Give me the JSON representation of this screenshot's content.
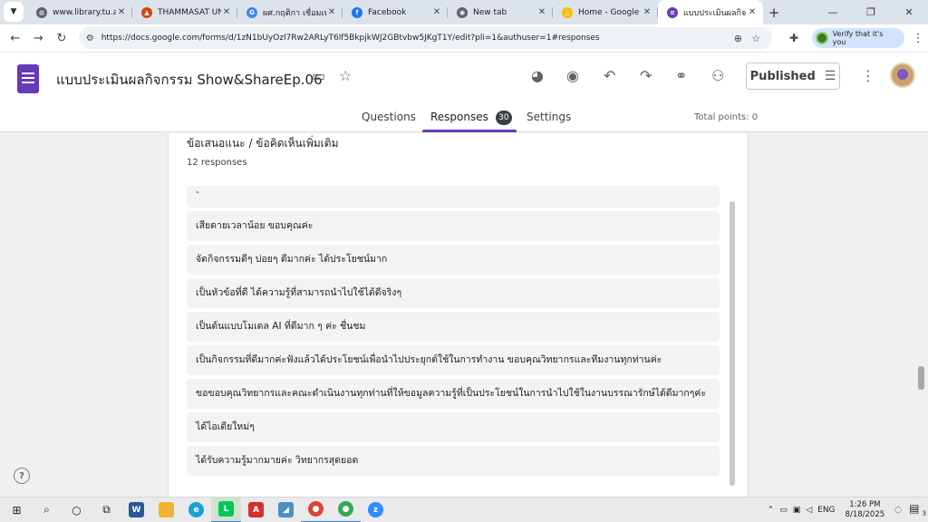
{
  "browser": {
    "tabs": [
      {
        "title": "www.library.tu.ac.th",
        "fav_color": "#5f6368",
        "fav_glyph": "◍"
      },
      {
        "title": "THAMMASAT UNIVERSITY",
        "fav_color": "#d84315",
        "fav_glyph": "▲"
      },
      {
        "title": "ผศ.กฤติกา เชื่อมเพชร",
        "fav_color": "#4285f4",
        "fav_glyph": "G"
      },
      {
        "title": "Facebook",
        "fav_color": "#1877f2",
        "fav_glyph": "f"
      },
      {
        "title": "New tab",
        "fav_color": "#5f6368",
        "fav_glyph": "◉"
      },
      {
        "title": "Home - Google Drive",
        "fav_color": "#fbbc04",
        "fav_glyph": "△"
      },
      {
        "title": "แบบประเมินผลกิจกรรม Show",
        "fav_color": "#673ab7",
        "fav_glyph": "≡"
      }
    ],
    "active_tab_index": 6,
    "url": "https://docs.google.com/forms/d/1zN1bUyOzl7Rw2ARLyT6lf5BkpjkWJ2GBtvbw5JKgT1Y/edit?pli=1&authuser=1#responses",
    "verify_label": "Verify that it's you"
  },
  "form": {
    "title": "แบบประเมินผลกิจกรรม Show&ShareEp.06",
    "publish_label": "Published",
    "tabs": {
      "questions": "Questions",
      "responses": "Responses",
      "responses_count": "30",
      "settings": "Settings"
    },
    "total_points": "Total points: 0"
  },
  "question": {
    "title": "ข้อเสนอแนะ / ข้อคิดเห็นเพิ่มเติม",
    "response_count_label": "12 responses",
    "responses": [
      "-",
      "เสียดายเวลาน้อย ขอบคุณค่ะ",
      "จัดกิจกรรมดีๆ บ่อยๆ ดีมากค่ะ ได้ประโยชน์มาก",
      "เป็นหัวข้อที่ดี ได้ความรู้ที่สามารถนำไปใช้ได้ดีจริงๆ",
      "เป็นต้นแบบโมเดล AI ที่ดีมาก ๆ ค่ะ ชื่นชม",
      "เป็นกิจกรรมที่ดีมากค่ะฟังแล้วได้ประโยชน์เพื่อนำไปประยุกต์ใช้ในการทำงาน ขอบคุณวิทยากรและทีมงานทุกท่านค่ะ",
      "ขอขอบคุณวิทยากรและคณะดำเนินงานทุกท่านที่ให้ขอมูลความรู้ที่เป็นประโยชน์ในการนำไปใช้ในงานบรรณารักษ์ได้ดีมากๆค่ะ",
      "ได้ไอเดียใหม่ๆ",
      "ได้รับความรู้มากมายค่ะ วิทยากรสุดยอด"
    ]
  },
  "taskbar": {
    "language": "ENG",
    "time": "1:26 PM",
    "date": "8/18/2025",
    "notification_count": "3"
  },
  "colors": {
    "accent": "#673ab7",
    "tab_strip": "#dde3ea",
    "response_bg": "#f1f3f4"
  }
}
